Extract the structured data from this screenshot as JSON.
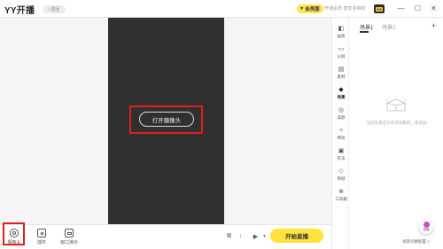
{
  "titlebar": {
    "app_title": "YY开播",
    "back_label": "返回",
    "vip_label": "会员版",
    "vip_promo": "开通会员 尊享多特权",
    "minimize_glyph": "—",
    "maximize_glyph": "☐",
    "close_glyph": "✕"
  },
  "preview": {
    "open_camera_label": "打开摄像头"
  },
  "bottom_tools": [
    {
      "label": "摄像头"
    },
    {
      "label": "插件"
    },
    {
      "label": "窗口演示"
    }
  ],
  "start_live_label": "开始直播",
  "right_column": [
    {
      "label": "画质",
      "glyph": "◧"
    },
    {
      "label": "公屏",
      "glyph": "▭"
    },
    {
      "label": "素材",
      "glyph": "▤"
    },
    {
      "label": "场景",
      "glyph": "◆"
    },
    {
      "label": "美颜",
      "glyph": "◎"
    },
    {
      "label": "特效",
      "glyph": "✧"
    },
    {
      "label": "玩法",
      "glyph": "▣"
    },
    {
      "label": "商城",
      "glyph": "◇"
    },
    {
      "label": "工具箱",
      "glyph": "⊕"
    }
  ],
  "panel": {
    "tabs": [
      {
        "label": "场景1"
      },
      {
        "label": "场景2"
      }
    ],
    "add_glyph": "+",
    "empty_text": "当前场景还没有添加素材，请添加!",
    "float_label": "直播",
    "footer_link": "场景切换配置 >"
  },
  "colors": {
    "accent_yellow": "#ffe33b",
    "highlight_red": "#e02020",
    "video_bg": "#303030"
  }
}
